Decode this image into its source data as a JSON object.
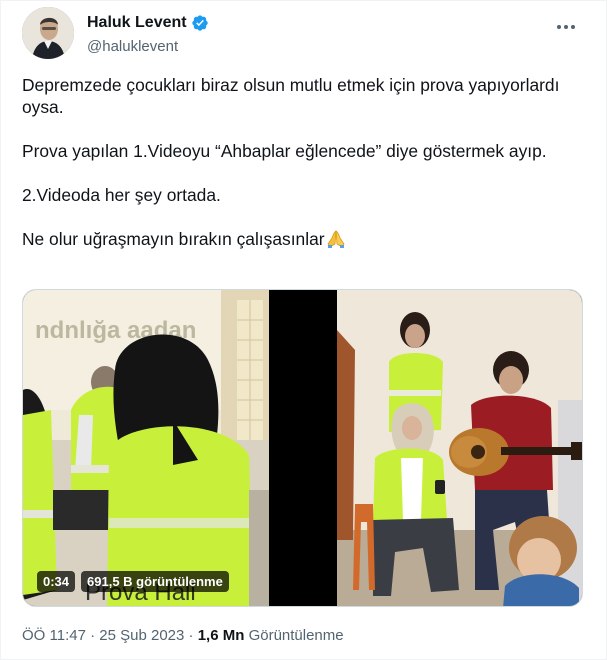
{
  "author": {
    "display_name": "Haluk Levent",
    "handle": "@haluklevent",
    "avatar_icon": "profile-photo",
    "verified_color": "#1d9bf0"
  },
  "tweet": {
    "paragraphs": [
      "Depremzede çocukları biraz olsun mutlu etmek için prova yapıyorlardı oysa.",
      "Prova yapılan 1.Videoyu “Ahbaplar eğlencede” diye göstermek ayıp.",
      "2.Videoda her şey ortada.",
      "Ne olur uğraşmayın bırakın çalışasınlar"
    ],
    "trailing_emoji": "folded-hands-emoji"
  },
  "media": {
    "duration": "0:34",
    "views_label": "691,5 B görüntülenme",
    "overlay_caption": "Prova Hali",
    "wall_sign": "ndnlığa aadan"
  },
  "meta": {
    "time": "ÖÖ 11:47",
    "separator": "·",
    "date": "25 Şub 2023",
    "views_count": "1,6 Mn",
    "views_word": "Görüntülenme"
  },
  "colors": {
    "text_primary": "#0f1419",
    "text_secondary": "#536471",
    "vest_yellow": "#c8f03a"
  }
}
